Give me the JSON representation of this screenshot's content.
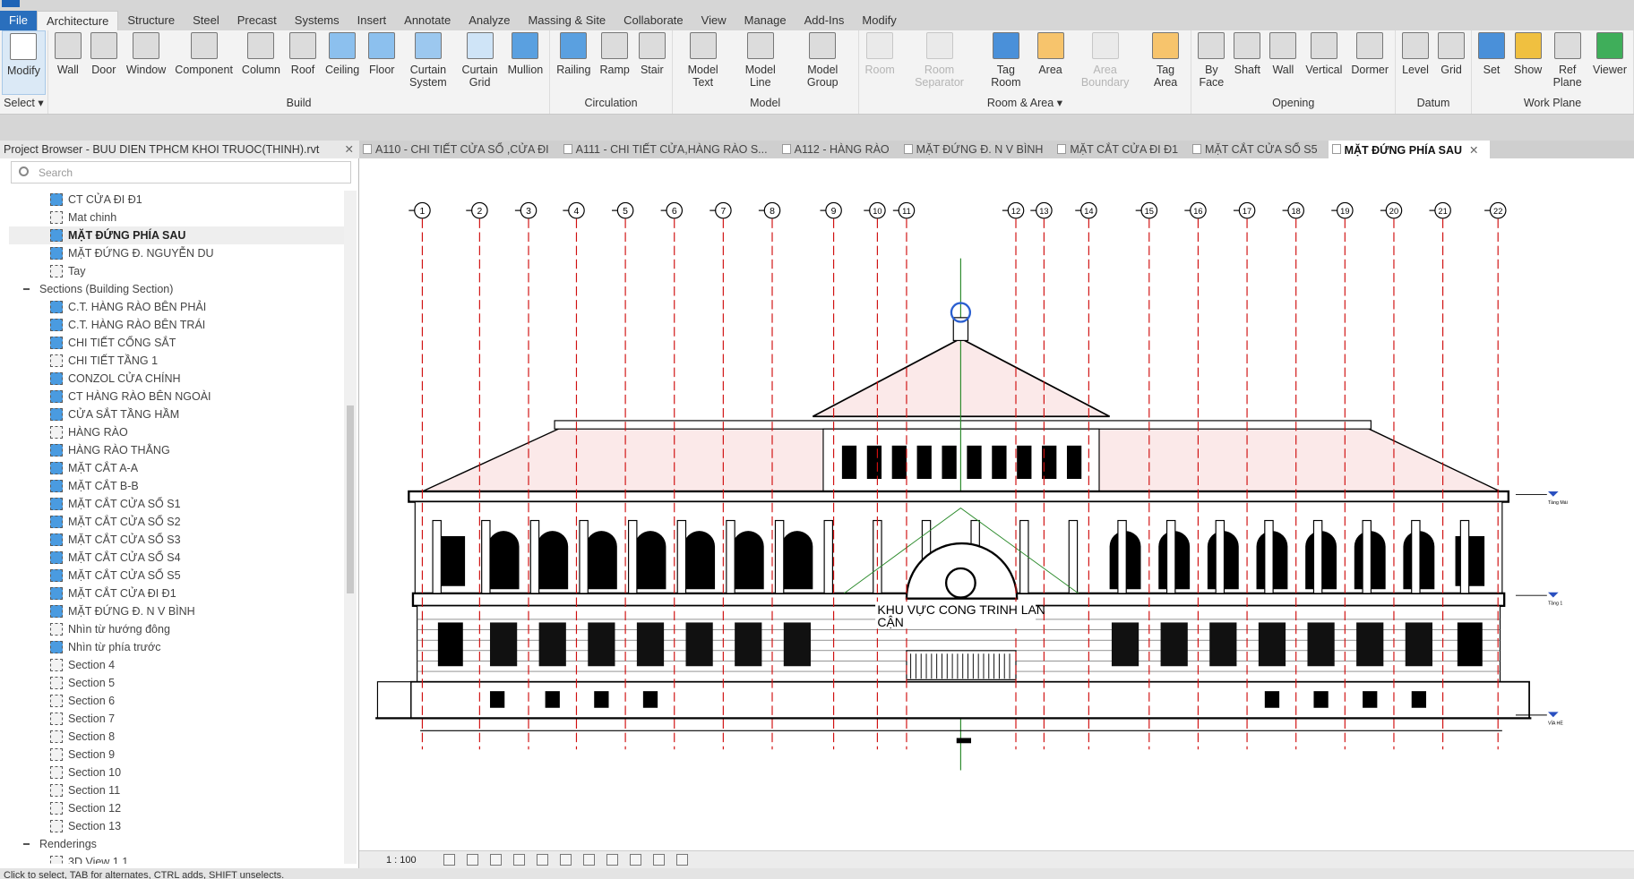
{
  "app": {
    "tabs": [
      "File",
      "Architecture",
      "Structure",
      "Steel",
      "Precast",
      "Systems",
      "Insert",
      "Annotate",
      "Analyze",
      "Massing & Site",
      "Collaborate",
      "View",
      "Manage",
      "Add-Ins",
      "Modify"
    ],
    "active_tab": "Architecture"
  },
  "ribbon": [
    {
      "title": "Select ▾",
      "buttons": [
        {
          "label": "Modify",
          "icon": "cursor-arrow-icon",
          "selected": true
        }
      ]
    },
    {
      "title": "Build",
      "buttons": [
        {
          "label": "Wall",
          "icon": "wall-icon"
        },
        {
          "label": "Door",
          "icon": "door-icon"
        },
        {
          "label": "Window",
          "icon": "window-icon"
        },
        {
          "label": "Component",
          "icon": "component-icon"
        },
        {
          "label": "Column",
          "icon": "column-icon"
        },
        {
          "label": "Roof",
          "icon": "roof-icon"
        },
        {
          "label": "Ceiling",
          "icon": "ceiling-icon"
        },
        {
          "label": "Floor",
          "icon": "floor-icon"
        },
        {
          "label": "Curtain System",
          "icon": "curtain-system-icon"
        },
        {
          "label": "Curtain Grid",
          "icon": "curtain-grid-icon"
        },
        {
          "label": "Mullion",
          "icon": "mullion-icon"
        }
      ]
    },
    {
      "title": "Circulation",
      "buttons": [
        {
          "label": "Railing",
          "icon": "railing-icon"
        },
        {
          "label": "Ramp",
          "icon": "ramp-icon"
        },
        {
          "label": "Stair",
          "icon": "stair-icon"
        }
      ]
    },
    {
      "title": "Model",
      "buttons": [
        {
          "label": "Model Text",
          "icon": "model-text-icon"
        },
        {
          "label": "Model Line",
          "icon": "model-line-icon"
        },
        {
          "label": "Model Group",
          "icon": "model-group-icon"
        }
      ]
    },
    {
      "title": "Room & Area ▾",
      "buttons": [
        {
          "label": "Room",
          "icon": "room-icon",
          "disabled": true
        },
        {
          "label": "Room Separator",
          "icon": "room-separator-icon",
          "disabled": true
        },
        {
          "label": "Tag Room",
          "icon": "tag-room-icon"
        },
        {
          "label": "Area",
          "icon": "area-icon"
        },
        {
          "label": "Area Boundary",
          "icon": "area-boundary-icon",
          "disabled": true
        },
        {
          "label": "Tag Area",
          "icon": "tag-area-icon"
        }
      ]
    },
    {
      "title": "Opening",
      "buttons": [
        {
          "label": "By Face",
          "icon": "by-face-icon"
        },
        {
          "label": "Shaft",
          "icon": "shaft-icon"
        },
        {
          "label": "Wall",
          "icon": "wall-opening-icon"
        },
        {
          "label": "Vertical",
          "icon": "vertical-icon"
        },
        {
          "label": "Dormer",
          "icon": "dormer-icon"
        }
      ]
    },
    {
      "title": "Datum",
      "buttons": [
        {
          "label": "Level",
          "icon": "level-icon"
        },
        {
          "label": "Grid",
          "icon": "grid-icon"
        }
      ]
    },
    {
      "title": "Work Plane",
      "buttons": [
        {
          "label": "Set",
          "icon": "set-icon"
        },
        {
          "label": "Show",
          "icon": "show-icon"
        },
        {
          "label": "Ref Plane",
          "icon": "ref-plane-icon"
        },
        {
          "label": "Viewer",
          "icon": "viewer-icon"
        }
      ]
    }
  ],
  "project_browser": {
    "title": "Project Browser - BUU DIEN TPHCM KHOI TRUOC(THINH).rvt",
    "search_placeholder": "Search",
    "items": [
      {
        "label": "CT CỬA ĐI Đ1",
        "blue": true
      },
      {
        "label": "Mat chinh",
        "blue": false
      },
      {
        "label": "MẶT ĐỨNG PHÍA SAU",
        "blue": true,
        "selected": true
      },
      {
        "label": "MẶT ĐỨNG Đ. NGUYỄN DU",
        "blue": true
      },
      {
        "label": "Tay",
        "blue": false
      },
      {
        "label": "Sections (Building Section)",
        "group": true
      },
      {
        "label": "C.T. HÀNG RÀO BÊN PHẢI",
        "blue": true
      },
      {
        "label": "C.T. HÀNG RÀO BÊN TRÁI",
        "blue": true
      },
      {
        "label": "CHI TIẾT CỔNG SẮT",
        "blue": true
      },
      {
        "label": "CHI TIẾT TẦNG 1",
        "blue": false
      },
      {
        "label": "CONZOL CỬA CHÍNH",
        "blue": true
      },
      {
        "label": "CT HÀNG RÀO BÊN NGOÀI",
        "blue": true
      },
      {
        "label": "CỬA SẮT TẦNG HẦM",
        "blue": true
      },
      {
        "label": "HÀNG RÀO",
        "blue": false
      },
      {
        "label": "HÀNG RÀO THẲNG",
        "blue": true
      },
      {
        "label": "MẶT CẮT A-A",
        "blue": true
      },
      {
        "label": "MẶT CẮT B-B",
        "blue": true
      },
      {
        "label": "MẶT CẮT CỬA SỔ S1",
        "blue": true
      },
      {
        "label": "MẶT CẮT CỬA SỔ S2",
        "blue": true
      },
      {
        "label": "MẶT CẮT CỬA SỔ S3",
        "blue": true
      },
      {
        "label": "MẶT CẮT CỬA SỔ S4",
        "blue": true
      },
      {
        "label": "MẶT CẮT CỬA SỔ S5",
        "blue": true
      },
      {
        "label": "MẶT CẮT CỬA ĐI Đ1",
        "blue": true
      },
      {
        "label": "MẶT ĐỨNG Đ. N V BÌNH",
        "blue": true
      },
      {
        "label": "Nhìn từ hướng đông",
        "blue": false
      },
      {
        "label": "Nhìn từ phía trước",
        "blue": true
      },
      {
        "label": "Section 4",
        "blue": false
      },
      {
        "label": "Section 5",
        "blue": false
      },
      {
        "label": "Section 6",
        "blue": false
      },
      {
        "label": "Section 7",
        "blue": false
      },
      {
        "label": "Section 8",
        "blue": false
      },
      {
        "label": "Section 9",
        "blue": false
      },
      {
        "label": "Section 10",
        "blue": false
      },
      {
        "label": "Section 11",
        "blue": false
      },
      {
        "label": "Section 12",
        "blue": false
      },
      {
        "label": "Section 13",
        "blue": false
      },
      {
        "label": "Renderings",
        "group": true
      },
      {
        "label": "3D View 1 1",
        "blue": false
      }
    ]
  },
  "view_tabs": [
    {
      "label": "A110 - CHI TIẾT  CỬA SỔ ,CỬA ĐI"
    },
    {
      "label": "A111 - CHI TIẾT CỬA,HÀNG RÀO S..."
    },
    {
      "label": "A112 - HÀNG RÀO"
    },
    {
      "label": "MẶT ĐỨNG Đ. N V BÌNH"
    },
    {
      "label": "MẶT CẮT CỬA ĐI  Đ1"
    },
    {
      "label": "MẶT CẮT CỬA SỔ  S5"
    },
    {
      "label": "MẶT ĐỨNG PHÍA SAU",
      "active": true
    }
  ],
  "drawing": {
    "grid_labels": [
      "1",
      "2",
      "3",
      "4",
      "5",
      "6",
      "7",
      "8",
      "9",
      "10",
      "11",
      "12",
      "13",
      "14",
      "15",
      "16",
      "17",
      "18",
      "19",
      "20",
      "21",
      "22"
    ],
    "annotation_line1": "KHU VỰC CONG TRINH LAN",
    "annotation_line2": "CẬN",
    "levels": [
      "Tầng Mái",
      "Tầng 1",
      "VỈA HÈ"
    ],
    "colors": {
      "grid": "#d01010",
      "roof": "#fbe9e9",
      "line": "#000000",
      "sketch": "#2a8a2a"
    }
  },
  "view_control": {
    "scale": "1 : 100"
  },
  "status": "Click to select, TAB for alternates, CTRL adds, SHIFT unselects."
}
